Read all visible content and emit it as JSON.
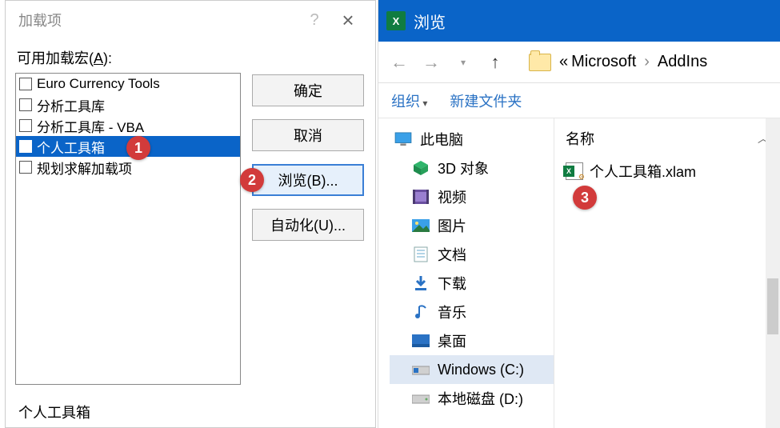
{
  "left": {
    "title": "加载项",
    "available_label_prefix": "可用加载宏(",
    "available_label_key": "A",
    "available_label_suffix": "):",
    "items": [
      {
        "label": "Euro Currency Tools",
        "selected": false
      },
      {
        "label": "分析工具库",
        "selected": false
      },
      {
        "label": "分析工具库 - VBA",
        "selected": false
      },
      {
        "label": "个人工具箱",
        "selected": true
      },
      {
        "label": "规划求解加载项",
        "selected": false
      }
    ],
    "buttons": {
      "ok": "确定",
      "cancel": "取消",
      "browse": "浏览(B)...",
      "automation": "自动化(U)..."
    },
    "status": "个人工具箱"
  },
  "right": {
    "title": "浏览",
    "crumbs": [
      "Microsoft",
      "AddIns"
    ],
    "toolbar": {
      "organize": "组织",
      "newfolder": "新建文件夹"
    },
    "col_header": "名称",
    "tree": [
      {
        "name": "this-pc",
        "label": "此电脑",
        "icon": "monitor",
        "indent": 0
      },
      {
        "name": "3d-objects",
        "label": "3D 对象",
        "icon": "cube",
        "indent": 1
      },
      {
        "name": "videos",
        "label": "视频",
        "icon": "film",
        "indent": 1
      },
      {
        "name": "pictures",
        "label": "图片",
        "icon": "picture",
        "indent": 1
      },
      {
        "name": "documents",
        "label": "文档",
        "icon": "doc",
        "indent": 1
      },
      {
        "name": "downloads",
        "label": "下载",
        "icon": "download",
        "indent": 1
      },
      {
        "name": "music",
        "label": "音乐",
        "icon": "music",
        "indent": 1
      },
      {
        "name": "desktop",
        "label": "桌面",
        "icon": "desktop",
        "indent": 1
      },
      {
        "name": "drive-c",
        "label": "Windows (C:)",
        "icon": "drive-win",
        "indent": 1,
        "selected": true
      },
      {
        "name": "drive-d",
        "label": "本地磁盘 (D:)",
        "icon": "drive",
        "indent": 1
      }
    ],
    "files": [
      {
        "name": "个人工具箱.xlam"
      }
    ]
  },
  "callouts": {
    "c1": "1",
    "c2": "2",
    "c3": "3"
  },
  "colors": {
    "primary": "#0a64c8",
    "callout": "#d23b3b",
    "excel": "#107c41"
  }
}
